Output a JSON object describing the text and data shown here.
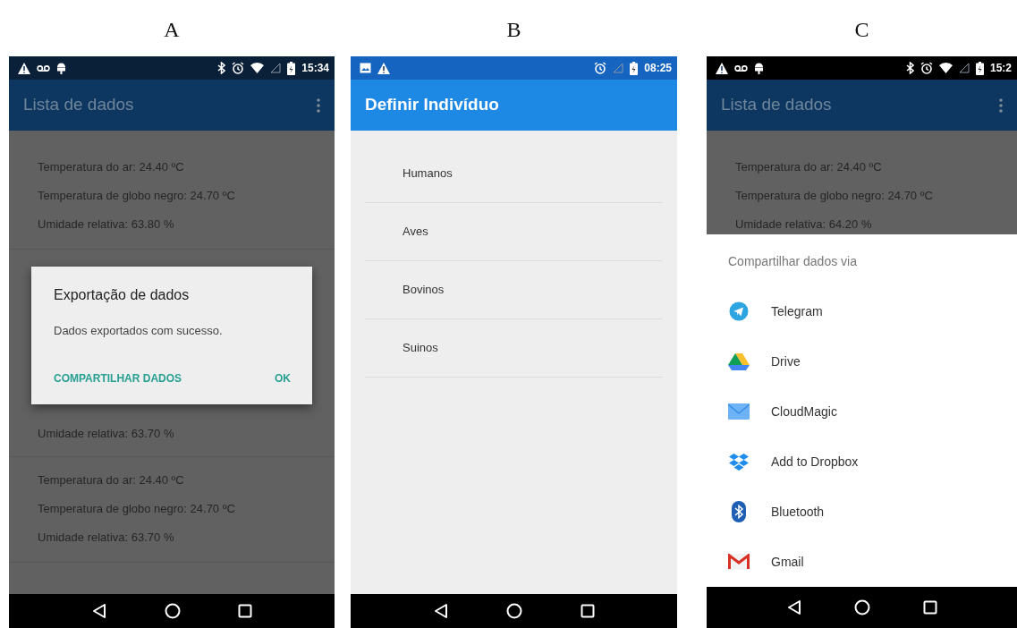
{
  "panels": [
    {
      "label": "A",
      "kind": "data-list",
      "dimmed": true,
      "status_bar": {
        "time": "15:34"
      },
      "app_bar": {
        "title": "Lista de dados",
        "menu": true
      },
      "groups": [
        {
          "rows": [
            "Temperatura do ar: 24.40 ºC",
            "Temperatura de globo negro: 24.70 ºC",
            "Umidade relativa: 63.80 %"
          ]
        },
        {
          "rows": [
            "Umidade relativa: 63.70 %"
          ]
        },
        {
          "rows": [
            "Temperatura do ar: 24.40 ºC",
            "Temperatura de globo negro: 24.70 ºC",
            "Umidade relativa: 63.70 %"
          ]
        }
      ],
      "dialog": {
        "title": "Exportação de dados",
        "message": "Dados exportados com sucesso.",
        "buttons": [
          "COMPARTILHAR DADOS",
          "OK"
        ]
      }
    },
    {
      "label": "B",
      "kind": "option-list",
      "dimmed": false,
      "status_bar": {
        "time": "08:25"
      },
      "app_bar": {
        "title": "Definir Indivíduo",
        "menu": false
      },
      "items": [
        "Humanos",
        "Aves",
        "Bovinos",
        "Suinos"
      ]
    },
    {
      "label": "C",
      "kind": "share-sheet",
      "dimmed": true,
      "status_bar": {
        "time": "15:2"
      },
      "app_bar": {
        "title": "Lista de dados",
        "menu": true
      },
      "groups": [
        {
          "rows": [
            "Temperatura do ar: 24.40 ºC",
            "Temperatura de globo negro: 24.70 ºC",
            "Umidade relativa: 64.20 %"
          ]
        }
      ],
      "sheet": {
        "title": "Compartilhar dados via",
        "items": [
          "Telegram",
          "Drive",
          "CloudMagic",
          "Add to Dropbox",
          "Bluetooth",
          "Gmail"
        ]
      }
    }
  ]
}
